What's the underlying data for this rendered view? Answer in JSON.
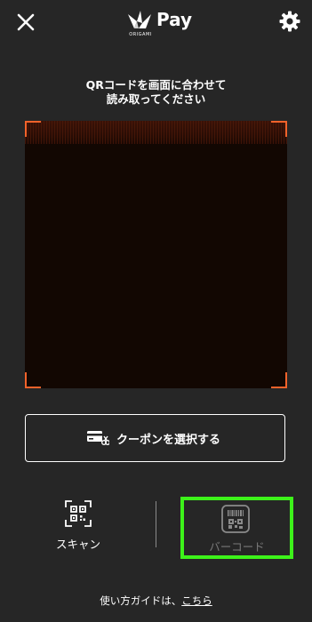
{
  "header": {
    "brand_sub": "ORIGAMI",
    "brand_name": "Pay",
    "close_icon": "close-icon",
    "settings_icon": "gear-icon"
  },
  "scanner": {
    "instruction_line1": "QRコードを画面に合わせて",
    "instruction_line2": "読み取ってください",
    "frame_color": "#f2622a"
  },
  "coupon": {
    "label": "クーポンを選択する",
    "icon": "coupon-card-scissors-icon"
  },
  "tabs": [
    {
      "label": "スキャン",
      "icon": "qr-scan-icon",
      "active": true
    },
    {
      "label": "バーコード",
      "icon": "barcode-qr-icon",
      "active": false
    }
  ],
  "footer": {
    "guide_prefix": "使い方ガイドは、",
    "guide_link": "こちら"
  },
  "colors": {
    "background": "#262626",
    "accent": "#f2622a",
    "highlight": "#3df21a",
    "inactive_text": "#7a7a7a"
  }
}
